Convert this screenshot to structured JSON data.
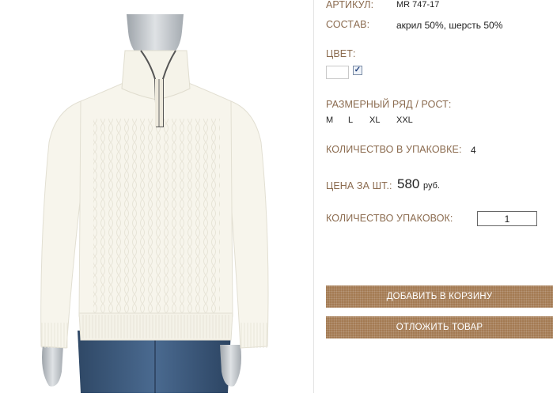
{
  "product": {
    "article_label": "АРТИКУЛ:",
    "article_value": "MR 747-17",
    "composition_label": "СОСТАВ:",
    "composition_value": "акрил 50%, шерсть 50%",
    "color_label": "ЦВЕТ:",
    "color_swatch": "#ffffff",
    "color_checked": true,
    "sizes_label": "РАЗМЕРНЫЙ РЯД / РОСТ:",
    "sizes": [
      "M",
      "L",
      "XL",
      "XXL"
    ],
    "pack_qty_label": "КОЛИЧЕСТВО В УПАКОВКЕ:",
    "pack_qty_value": "4",
    "price_label": "ЦЕНА ЗА ШТ.:",
    "price_value": "580",
    "price_currency": "руб.",
    "packs_label": "КОЛИЧЕСТВО УПАКОВОК:",
    "packs_value": "1"
  },
  "actions": {
    "add_to_cart": "ДОБАВИТЬ В КОРЗИНУ",
    "postpone": "ОТЛОЖИТЬ ТОВАР"
  },
  "colors": {
    "label": "#8b6b4f",
    "button": "#a37a52",
    "sweater": "#f7f5ec",
    "jeans": "#3a5577",
    "mannequin": "#b9bec3"
  }
}
